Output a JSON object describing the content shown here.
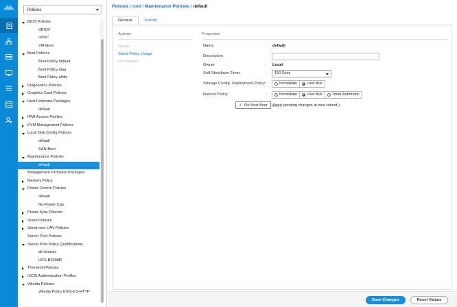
{
  "colors": {
    "rail": "#0b8ad7",
    "rail_active": "#066fb1",
    "accent": "#1a8ed6",
    "link": "#0b6eb5"
  },
  "rail": {
    "logo_icon": "cisco-logo-icon",
    "icons": [
      "server-icon",
      "network-topology-icon",
      "storage-icon",
      "chassis-icon",
      "vm-monitor-icon",
      "list-icon",
      "grid-icon",
      "admin-user-icon"
    ],
    "active_index": 0
  },
  "tree": {
    "filter_value": "Policies",
    "items": [
      {
        "label": "BIOS Policies",
        "level": 1,
        "twisty": "open"
      },
      {
        "label": "SRIOV",
        "level": 2
      },
      {
        "label": "usNIC",
        "level": 2
      },
      {
        "label": "VM-Host",
        "level": 2
      },
      {
        "label": "Boot Policies",
        "level": 1,
        "twisty": "open"
      },
      {
        "label": "Boot Policy default",
        "level": 2
      },
      {
        "label": "Boot Policy diag",
        "level": 2
      },
      {
        "label": "Boot Policy utility",
        "level": 2
      },
      {
        "label": "Diagnostics Policies",
        "level": 1,
        "twisty": "closed"
      },
      {
        "label": "Graphics Card Policies",
        "level": 1,
        "twisty": "closed"
      },
      {
        "label": "Host Firmware Packages",
        "level": 1,
        "twisty": "open"
      },
      {
        "label": "default",
        "level": 2
      },
      {
        "label": "IPMI Access Profiles",
        "level": 1,
        "twisty": "closed"
      },
      {
        "label": "KVM Management Policies",
        "level": 1,
        "twisty": "closed"
      },
      {
        "label": "Local Disk Config Policies",
        "level": 1,
        "twisty": "open"
      },
      {
        "label": "default",
        "level": 2
      },
      {
        "label": "SAN-Boot",
        "level": 2
      },
      {
        "label": "Maintenance Policies",
        "level": 1,
        "twisty": "open"
      },
      {
        "label": "default",
        "level": 2,
        "selected": true
      },
      {
        "label": "Management Firmware Packages",
        "level": 1
      },
      {
        "label": "Memory Policy",
        "level": 1,
        "twisty": "closed"
      },
      {
        "label": "Power Control Policies",
        "level": 1,
        "twisty": "open"
      },
      {
        "label": "default",
        "level": 2
      },
      {
        "label": "No-Power-Cap",
        "level": 2
      },
      {
        "label": "Power Sync Policies",
        "level": 1,
        "twisty": "closed"
      },
      {
        "label": "Scrub Policies",
        "level": 1,
        "twisty": "closed"
      },
      {
        "label": "Serial over LAN Policies",
        "level": 1,
        "twisty": "closed"
      },
      {
        "label": "Server Pool Policies",
        "level": 1
      },
      {
        "label": "Server Pool Policy Qualifications",
        "level": 1,
        "twisty": "open"
      },
      {
        "label": "all-chassis",
        "level": 2
      },
      {
        "label": "UCS-B200M5",
        "level": 2
      },
      {
        "label": "Threshold Policies",
        "level": 1,
        "twisty": "closed"
      },
      {
        "label": "iSCSI Authentication Profiles",
        "level": 1,
        "twisty": "closed"
      },
      {
        "label": "vMedia Policies",
        "level": 1,
        "twisty": "open"
      },
      {
        "label": "vMedia Policy ESXi-6.5-HTTP",
        "level": 2
      }
    ]
  },
  "breadcrumb": {
    "items": [
      "Policies",
      "root",
      "Maintenance Policies"
    ],
    "current": "default",
    "separator": "/"
  },
  "tabs": [
    {
      "label": "General",
      "active": true
    },
    {
      "label": "Events",
      "active": false
    }
  ],
  "actions": {
    "title": "Actions",
    "items": [
      {
        "label": "Delete",
        "enabled": false
      },
      {
        "label": "Show Policy Usage",
        "enabled": true
      },
      {
        "label": "Use Global",
        "enabled": false
      }
    ]
  },
  "properties": {
    "title": "Properties",
    "name": {
      "label": "Name",
      "value": "default"
    },
    "description": {
      "label": "Description",
      "value": ""
    },
    "owner": {
      "label": "Owner",
      "value": "Local"
    },
    "soft_shutdown": {
      "label": "Soft Shutdown Timer",
      "value": "150 Secs"
    },
    "storage_config": {
      "label": "Storage Config. Deployment Policy",
      "options": [
        "Immediate",
        "User Ack"
      ],
      "selected": "User Ack"
    },
    "reboot_policy": {
      "label": "Reboot Policy",
      "options": [
        "Immediate",
        "User Ack",
        "Timer Automatic"
      ],
      "selected": "User Ack"
    },
    "on_next_boot": {
      "label": "On Next Boot",
      "checked": true,
      "note": "(Apply pending changes at next reboot.)"
    },
    "colon": ":"
  },
  "footer": {
    "save_label": "Save Changes",
    "reset_label": "Reset Values"
  }
}
